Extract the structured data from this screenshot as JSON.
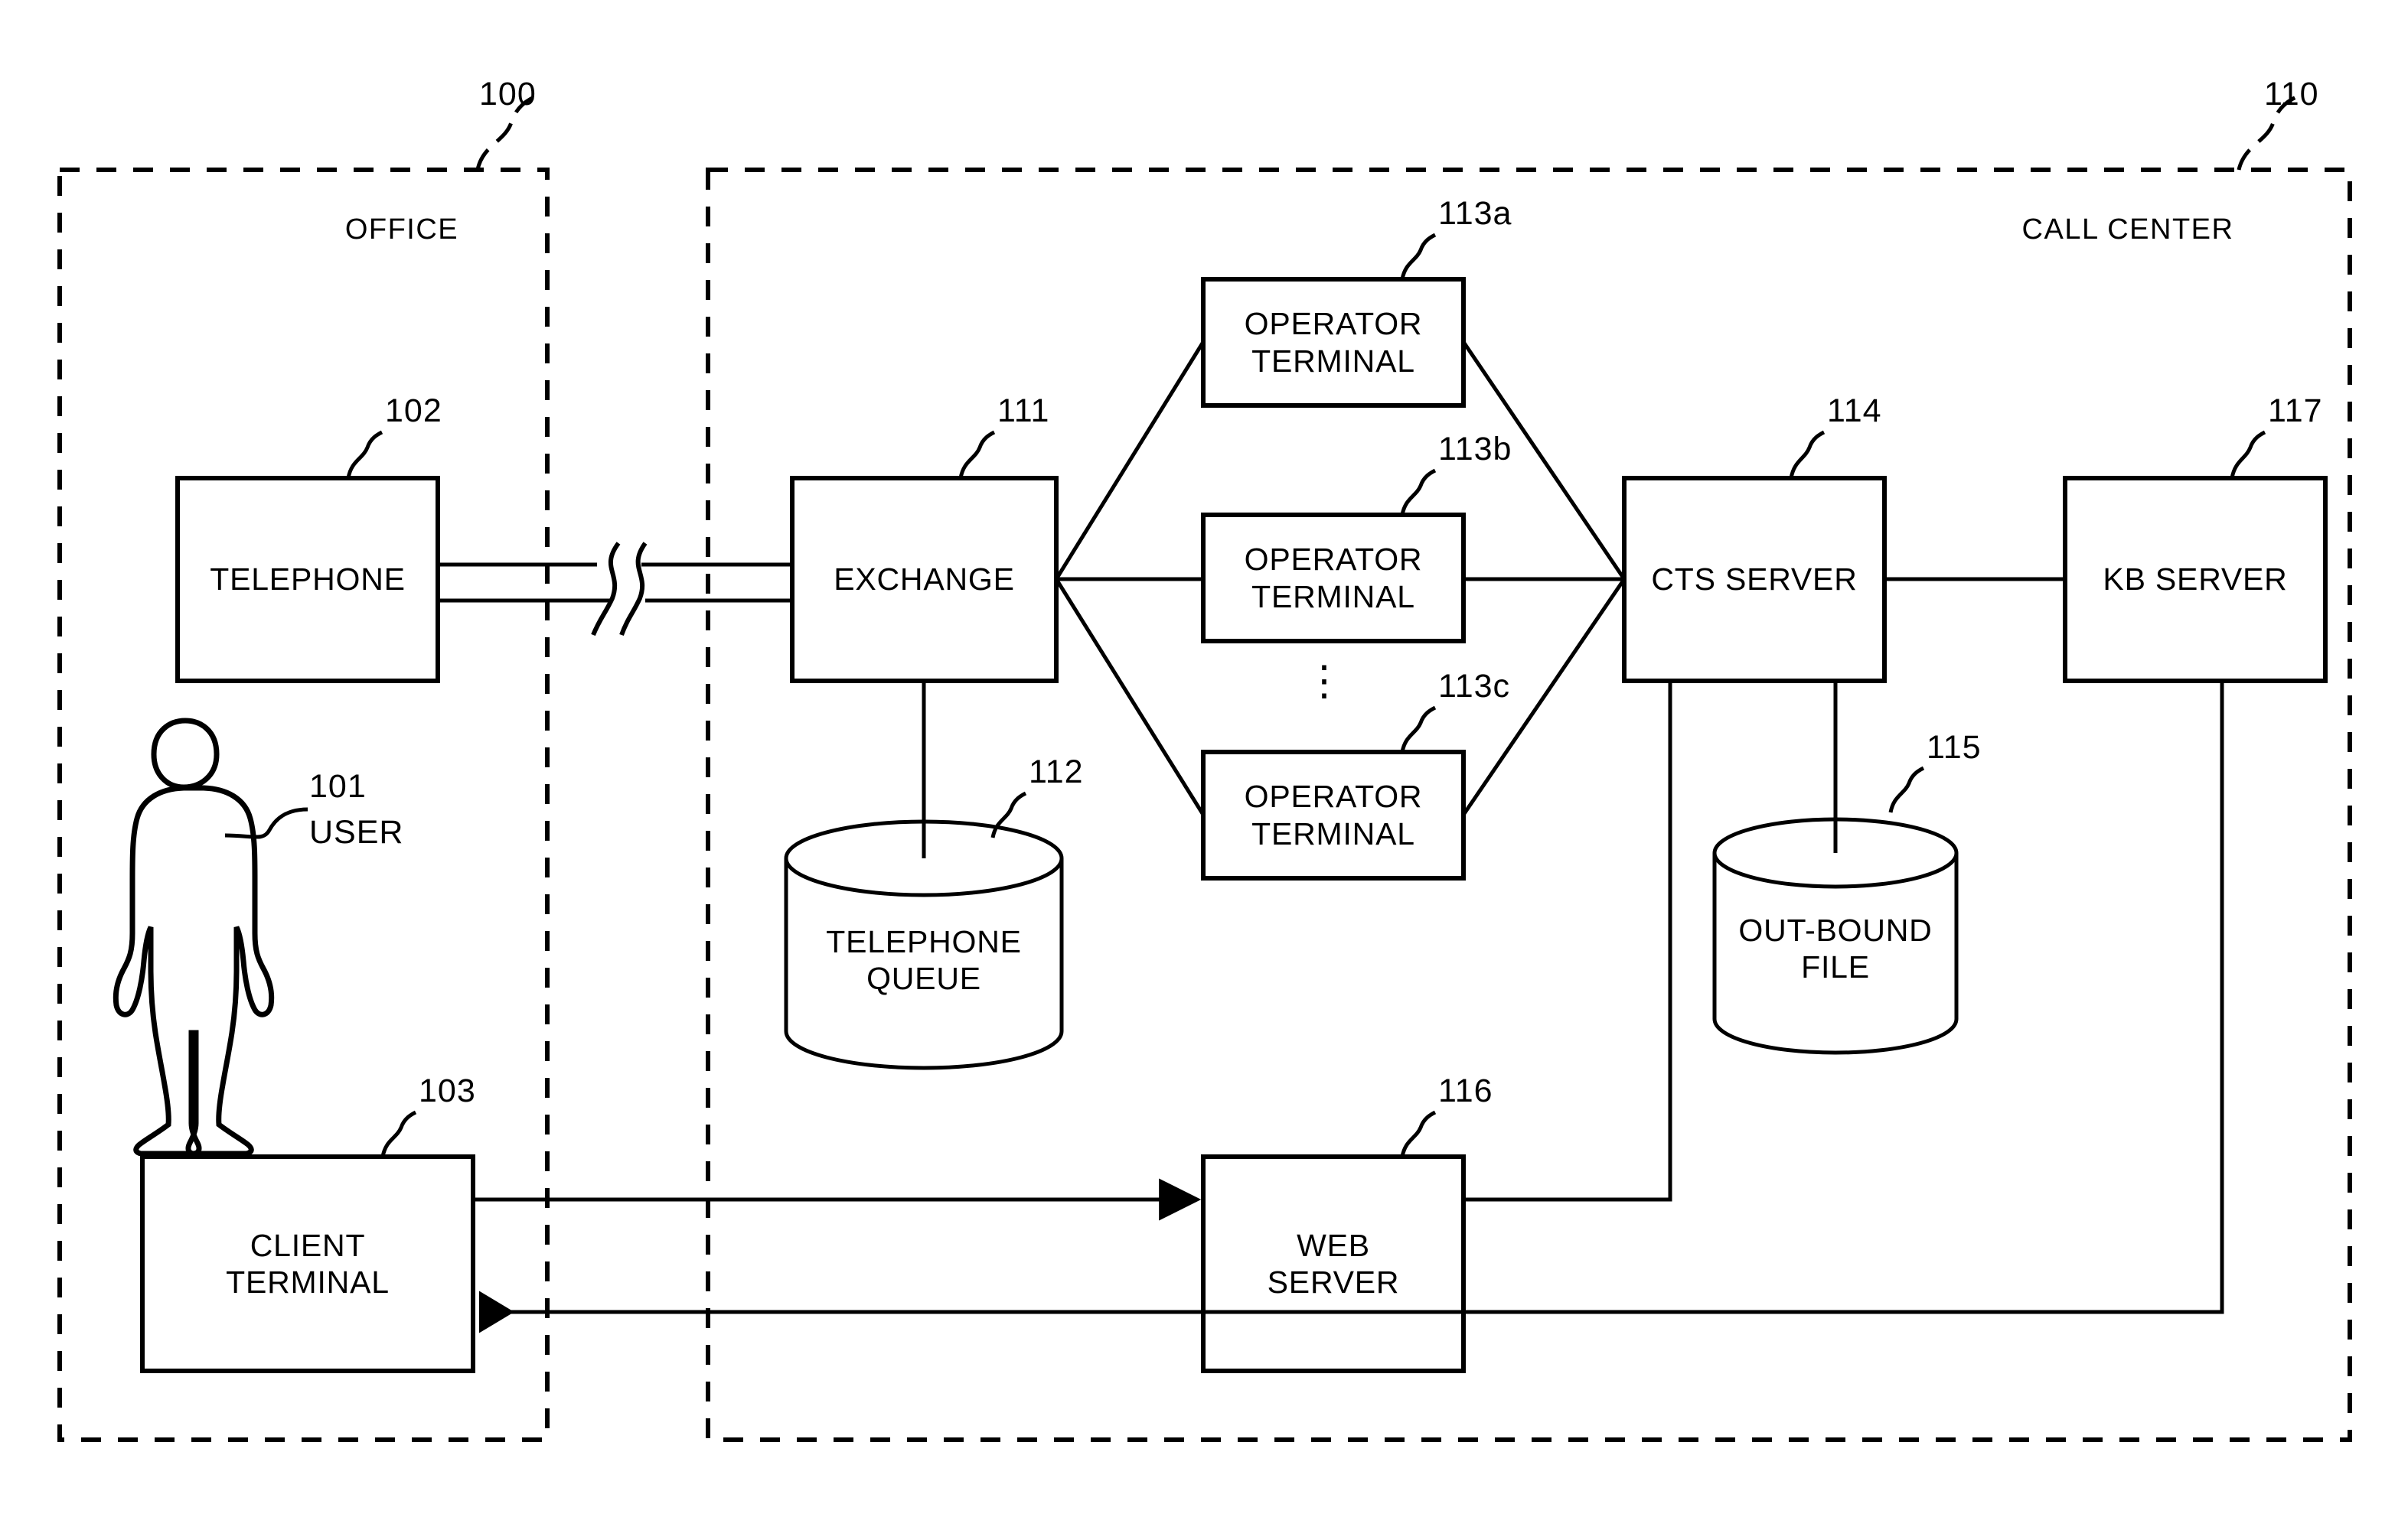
{
  "diagram": {
    "type": "patent-system-block-diagram",
    "zones": [
      {
        "id": "office",
        "label": "OFFICE",
        "ref": "100"
      },
      {
        "id": "call_center",
        "label": "CALL CENTER",
        "ref": "110"
      }
    ],
    "nodes": [
      {
        "id": "user",
        "label": "USER",
        "ref": "101",
        "shape": "person"
      },
      {
        "id": "telephone",
        "label": "TELEPHONE",
        "ref": "102",
        "shape": "rect"
      },
      {
        "id": "client_terminal",
        "label": "CLIENT\nTERMINAL",
        "ref": "103",
        "shape": "rect"
      },
      {
        "id": "exchange",
        "label": "EXCHANGE",
        "ref": "111",
        "shape": "rect"
      },
      {
        "id": "telephone_queue",
        "label": "TELEPHONE\nQUEUE",
        "ref": "112",
        "shape": "cylinder"
      },
      {
        "id": "operator_a",
        "label": "OPERATOR\nTERMINAL",
        "ref": "113a",
        "shape": "rect"
      },
      {
        "id": "operator_b",
        "label": "OPERATOR\nTERMINAL",
        "ref": "113b",
        "shape": "rect"
      },
      {
        "id": "operator_c",
        "label": "OPERATOR\nTERMINAL",
        "ref": "113c",
        "shape": "rect"
      },
      {
        "id": "cts_server",
        "label": "CTS SERVER",
        "ref": "114",
        "shape": "rect"
      },
      {
        "id": "outbound_file",
        "label": "OUT-BOUND\nFILE",
        "ref": "115",
        "shape": "cylinder"
      },
      {
        "id": "web_server",
        "label": "WEB\nSERVER",
        "ref": "116",
        "shape": "rect"
      },
      {
        "id": "kb_server",
        "label": "KB SERVER",
        "ref": "117",
        "shape": "rect"
      }
    ],
    "ellipsis": "⋮",
    "line_color": "#000000",
    "background_color": "#ffffff"
  }
}
